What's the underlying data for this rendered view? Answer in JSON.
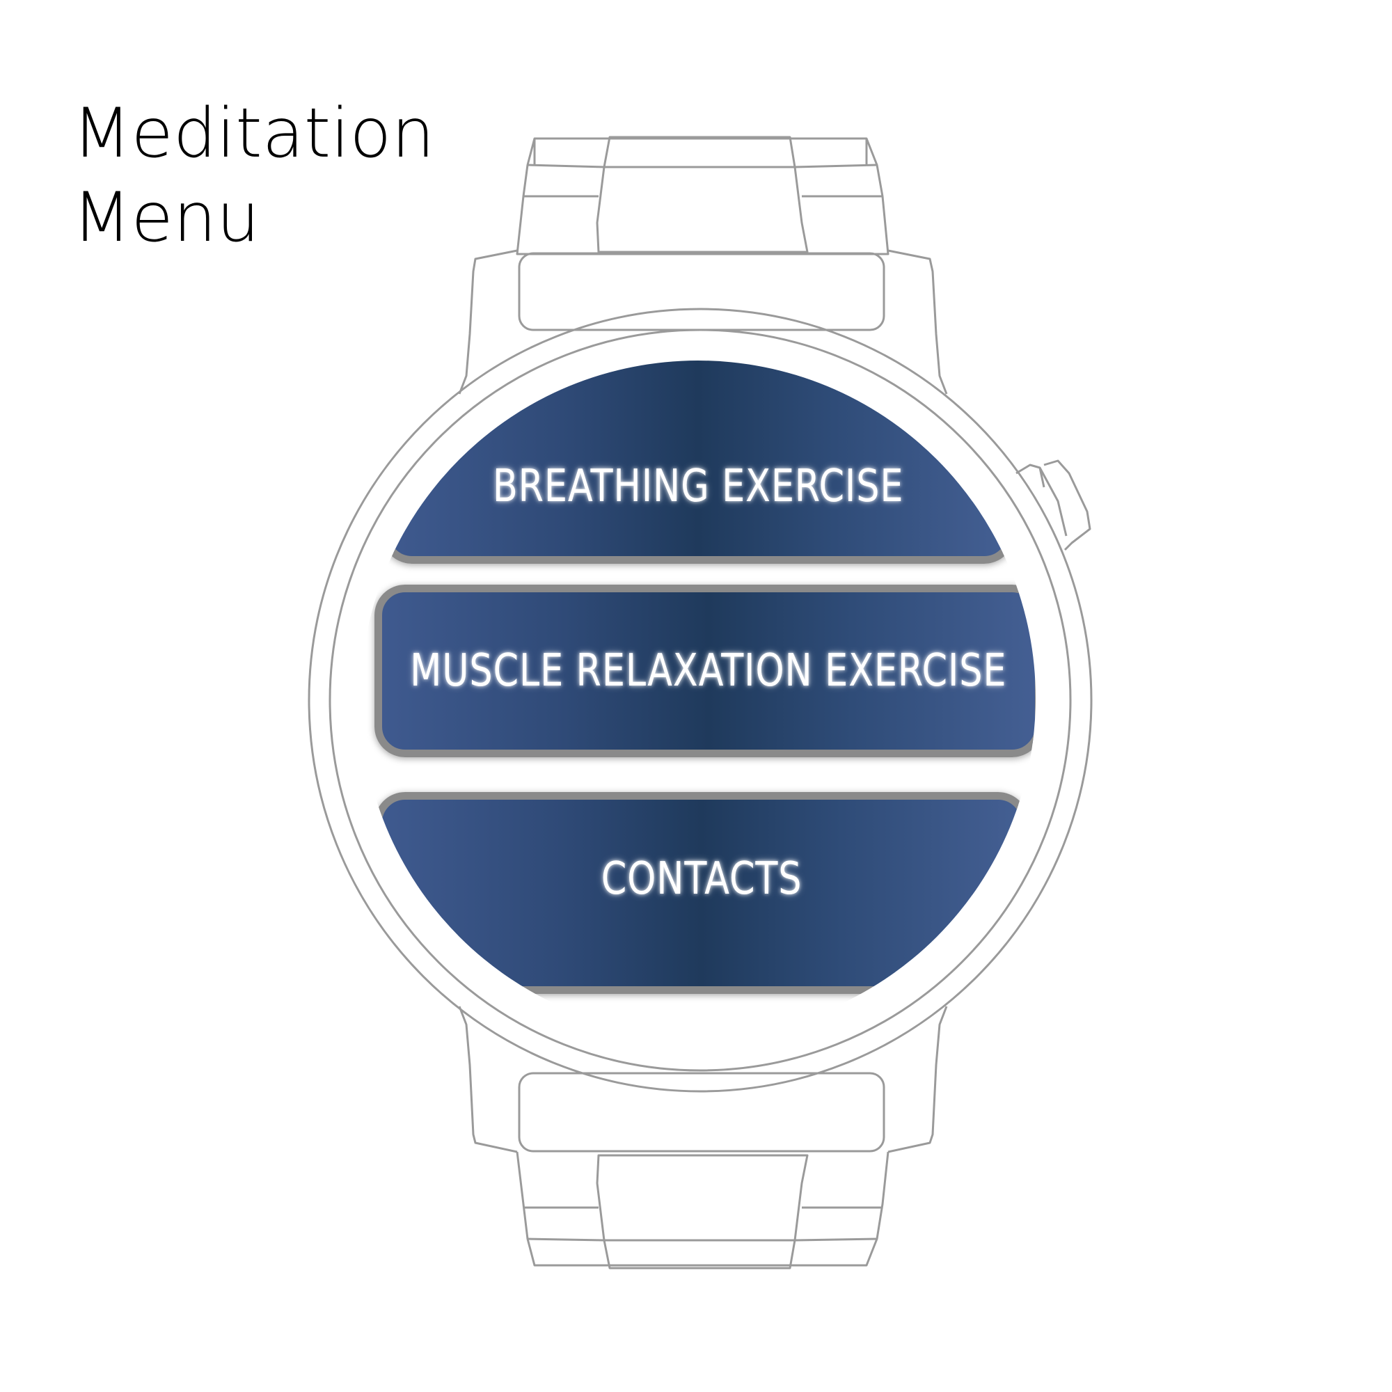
{
  "page": {
    "title_line1": "Meditation",
    "title_line2": "Menu"
  },
  "menu": {
    "items": [
      {
        "label": "BREATHING EXERCISE"
      },
      {
        "label": "MUSCLE RELAXATION EXERCISE"
      },
      {
        "label": "CONTACTS"
      }
    ],
    "colors": {
      "button_dark": "#1f3a5c",
      "button_light": "#445f93",
      "button_border": "#8a8a8a",
      "label": "#ffffff"
    }
  },
  "device": {
    "icon": "smartwatch-outline-icon",
    "outline_color": "#9a9a9a"
  }
}
